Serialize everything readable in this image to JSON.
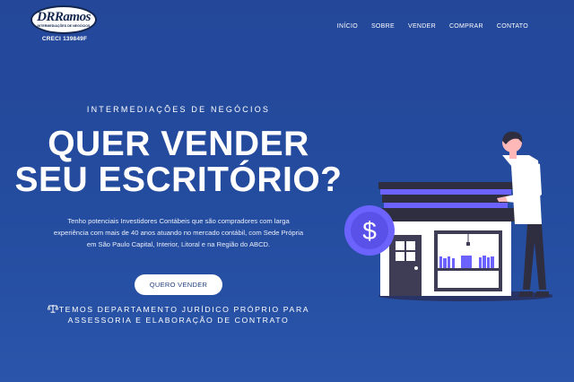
{
  "brand": {
    "logo_text": "DRRamos",
    "logo_subtitle": "INTERMEDIAÇÕES DE NEGÓCIOS",
    "creci": "CRECI 139849F"
  },
  "nav": {
    "items": [
      "INÍCIO",
      "SOBRE",
      "VENDER",
      "COMPRAR",
      "CONTATO"
    ]
  },
  "hero": {
    "kicker": "INTERMEDIAÇÕES DE NEGÓCIOS",
    "headline_line1": "QUER VENDER",
    "headline_line2": "SEU ESCRITÓRIO?",
    "body": "Tenho potenciais Investidores Contábeis que são compradores com larga experiência com mais de 40 anos atuando no mercado contábil, com Sede Própria em São Paulo Capital, Interior, Litoral e na Região do ABCD.",
    "cta_label": "QUERO VENDER",
    "legal_line1": "TEMOS DEPARTAMENTO JURÍDICO PRÓPRIO PARA",
    "legal_line2": "ASSESSORIA E ELABORAÇÃO DE CONTRATO"
  },
  "illustration": {
    "dollar_symbol": "$",
    "icons": [
      "dollar-icon",
      "scale-icon"
    ]
  },
  "colors": {
    "background": "#24479a",
    "accent_purple": "#6c63ff",
    "dark_navy": "#2f2e41",
    "text": "#ffffff",
    "button_text": "#23407f"
  }
}
